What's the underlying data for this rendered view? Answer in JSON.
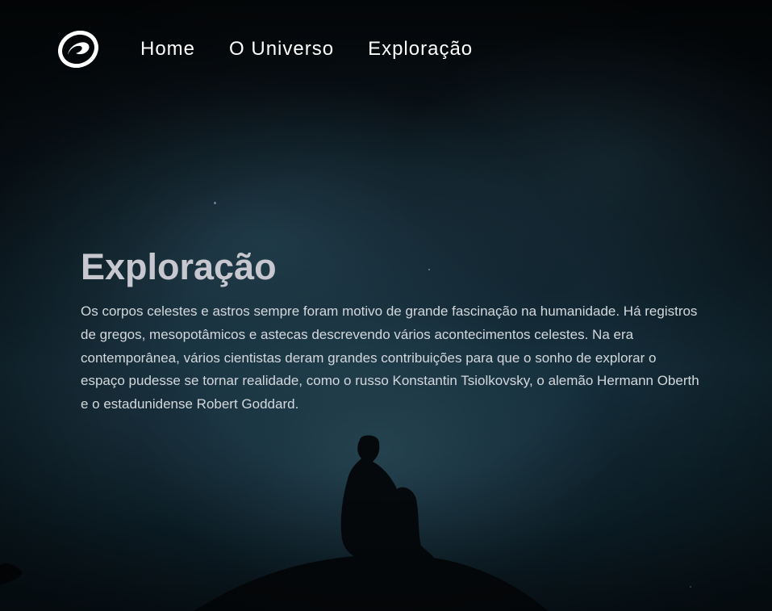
{
  "nav": {
    "logo": "swirl-logo",
    "links": [
      "Home",
      "O Universo",
      "Exploração"
    ]
  },
  "hero": {
    "title": "Exploração",
    "paragraph": "Os corpos celestes e astros sempre foram motivo de grande fascinação na humanidade. Há registros de gregos, mesopotâmicos e astecas descrevendo vários acontecimentos celestes. Na era contemporânea, vários cientistas deram grandes contribuições para que o sonho de explorar o espaço pudesse se tornar realidade, como o russo Konstantin Tsiolkovsky, o alemão Hermann Oberth e o estadunidense Robert Goddard."
  },
  "colors": {
    "nav_text": "#ffffff",
    "title": "#c7c7d0",
    "paragraph": "#d4d8dc",
    "background": "#0c1a22"
  }
}
